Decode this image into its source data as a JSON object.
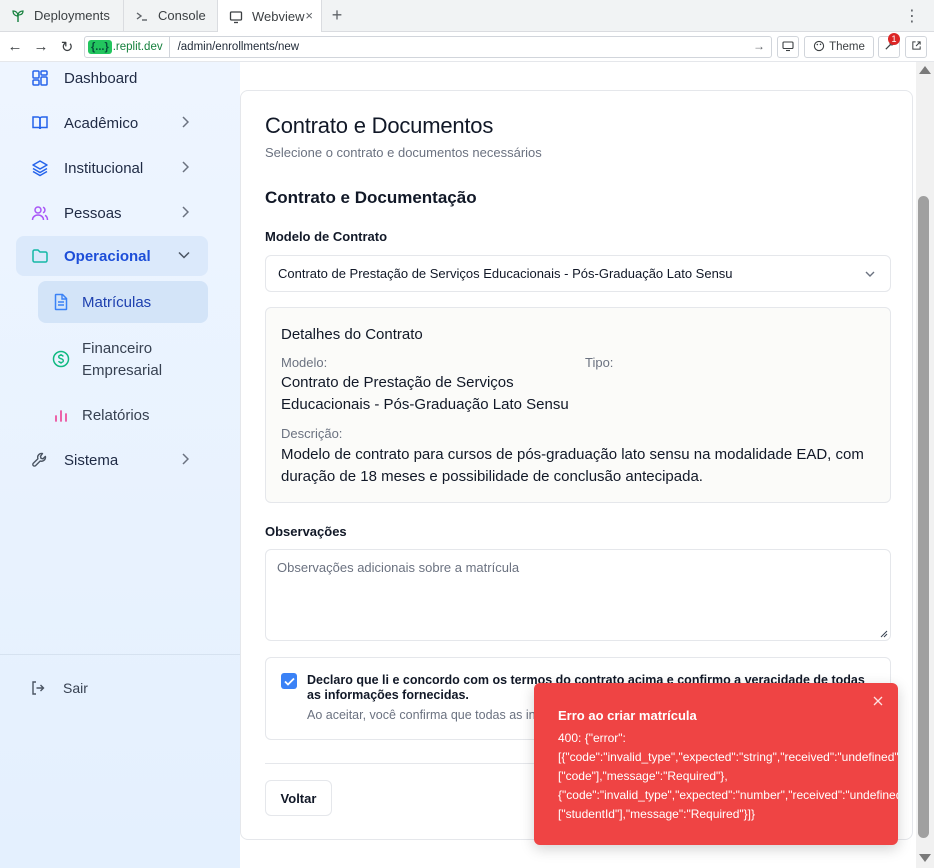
{
  "browser": {
    "tabs": [
      {
        "label": "Deployments",
        "icon": "sprout-icon"
      },
      {
        "label": "Console",
        "icon": "terminal-icon"
      },
      {
        "label": "Webview",
        "icon": "monitor-icon"
      }
    ],
    "tab_close": "×",
    "new_tab": "+",
    "menu": "⋮",
    "url_badge": "{...}",
    "url_host": ".replit.dev",
    "url_path": "/admin/enrollments/new",
    "theme_button": "Theme",
    "notification_count": "1"
  },
  "sidebar": {
    "items": [
      {
        "label": "Dashboard"
      },
      {
        "label": "Acadêmico"
      },
      {
        "label": "Institucional"
      },
      {
        "label": "Pessoas"
      },
      {
        "label": "Operacional"
      },
      {
        "label": "Matrículas"
      },
      {
        "label_line1": "Financeiro",
        "label_line2": "Empresarial"
      },
      {
        "label": "Relatórios"
      },
      {
        "label": "Sistema"
      }
    ],
    "logout": "Sair"
  },
  "main": {
    "card_title": "Contrato e Documentos",
    "card_subtitle": "Selecione o contrato e documentos necessários",
    "section_title": "Contrato e Documentação",
    "contract_model_label": "Modelo de Contrato",
    "contract_model_value": "Contrato de Prestação de Serviços Educacionais - Pós-Graduação Lato Sensu",
    "details": {
      "title": "Detalhes do Contrato",
      "model_label": "Modelo:",
      "model_line1": "Contrato de Prestação de Serviços",
      "model_line2": "Educacionais - Pós-Graduação Lato Sensu",
      "type_label": "Tipo:",
      "description_label": "Descrição:",
      "description_line1": "Modelo de contrato para cursos de pós-graduação lato sensu na modalidade EAD, com",
      "description_line2": "duração de 18 meses e possibilidade de conclusão antecipada."
    },
    "observations_label": "Observações",
    "observations_placeholder": "Observações adicionais sobre a matrícula",
    "consent": {
      "checked": true,
      "text": "Declaro que li e concordo com os termos do contrato acima e confirmo a veracidade de todas as informações fornecidas.",
      "subtext": "Ao aceitar, você confirma que todas as informações"
    },
    "back_button": "Voltar"
  },
  "toast": {
    "title": "Erro ao criar matrícula",
    "lines": [
      "400: {\"error\":",
      "[{\"code\":\"invalid_type\",\"expected\":\"string\",\"received\":\"undefined\",\"path\":",
      "[\"code\"],\"message\":\"Required\"},",
      "{\"code\":\"invalid_type\",\"expected\":\"number\",\"received\":\"undefined\",\"path\":",
      "[\"studentId\"],\"message\":\"Required\"}]}"
    ],
    "color": "#ef4444"
  },
  "colors": {
    "accent": "#3b82f6",
    "sidebar_bg": "#eaf3ff",
    "active_text": "#1d4ed8"
  }
}
